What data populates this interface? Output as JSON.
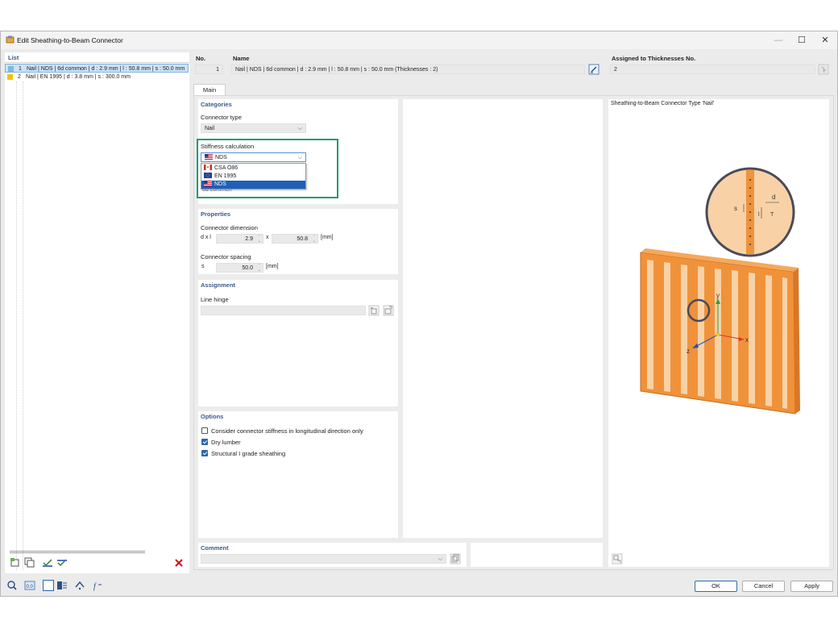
{
  "window": {
    "title": "Edit Sheathing-to-Beam Connector"
  },
  "list": {
    "header": "List",
    "items": [
      {
        "no": "1",
        "text": "Nail | NDS | 6d common | d : 2.9 mm | l : 50.8 mm | s : 50.0 mm",
        "color": "#7fb8e6",
        "selected": true
      },
      {
        "no": "2",
        "text": "Nail | EN 1995 | d : 3.8 mm | s : 300.0 mm",
        "color": "#f5c400",
        "selected": false
      }
    ]
  },
  "header": {
    "no_label": "No.",
    "no_value": "1",
    "name_label": "Name",
    "name_value": "Nail | NDS | 6d common | d : 2.9 mm | l : 50.8 mm | s : 50.0 mm (Thicknesses : 2)",
    "assigned_label": "Assigned to Thicknesses No.",
    "assigned_value": "2"
  },
  "tabs": [
    {
      "label": "Main"
    }
  ],
  "categories": {
    "title": "Categories",
    "connector_type_label": "Connector type",
    "connector_type_value": "Nail",
    "stiffness_label": "Stiffness calculation",
    "stiffness_value": "NDS",
    "options": [
      {
        "label": "CSA O86",
        "flag": "ca",
        "selected": false
      },
      {
        "label": "EN 1995",
        "flag": "eu",
        "selected": false
      },
      {
        "label": "NDS",
        "flag": "us",
        "selected": true
      }
    ],
    "hidden_text": "6d common"
  },
  "properties": {
    "title": "Properties",
    "dimension_label": "Connector dimension",
    "dimension_symbol": "d x l",
    "d_value": "2.9",
    "x_sep": "x",
    "l_value": "50.8",
    "dimension_unit": "[mm]",
    "spacing_label": "Connector spacing",
    "spacing_symbol": "s",
    "s_value": "50.0",
    "spacing_unit": "[mm]"
  },
  "assignment": {
    "title": "Assignment",
    "line_hinge_label": "Line hinge",
    "line_hinge_value": ""
  },
  "options": {
    "title": "Options",
    "items": [
      {
        "label": "Consider connector stiffness in longitudinal direction only",
        "checked": false
      },
      {
        "label": "Dry lumber",
        "checked": true
      },
      {
        "label": "Structural I grade sheathing",
        "checked": true
      }
    ]
  },
  "comment": {
    "title": "Comment",
    "value": ""
  },
  "preview": {
    "title": "Sheathing-to-Beam Connector Type 'Nail'",
    "axis_x": "x",
    "axis_y": "y",
    "axis_z": "z",
    "detail_s": "s",
    "detail_d": "d",
    "detail_l": "l",
    "detail_t": "T"
  },
  "footer": {
    "ok": "OK",
    "cancel": "Cancel",
    "apply": "Apply"
  },
  "colors": {
    "accent": "#2a66b5",
    "highlight": "#1a9a7a",
    "wood": "#f0923a",
    "wood_light": "#f8d2a6",
    "section_title": "#3b5a8a"
  }
}
